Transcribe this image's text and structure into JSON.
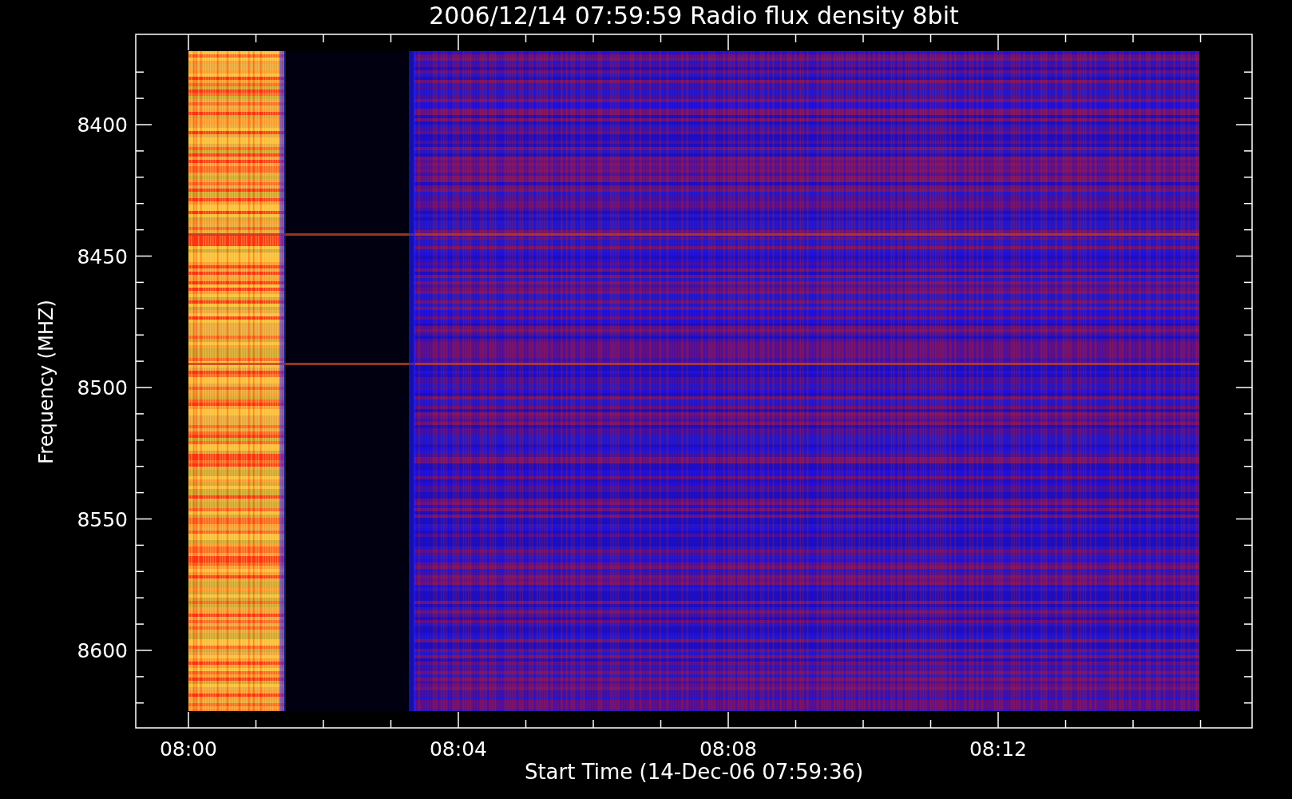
{
  "title": "2006/12/14 07:59:59 Radio flux density 8bit",
  "ylabel": "Frequency (MHZ)",
  "xlabel": "Start Time (14-Dec-06 07:59:36)",
  "yticks": [
    "8400",
    "8450",
    "8500",
    "8550",
    "8600"
  ],
  "xticks": [
    "08:00",
    "08:04",
    "08:08",
    "08:12"
  ]
}
